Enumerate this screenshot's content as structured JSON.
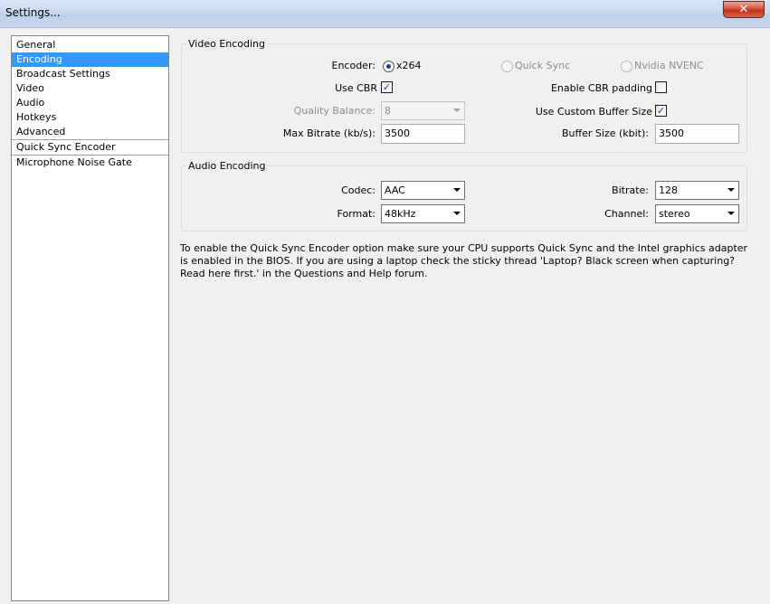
{
  "window": {
    "title": "Settings...",
    "close_glyph": "✕"
  },
  "sidebar": {
    "items": [
      {
        "label": "General"
      },
      {
        "label": "Encoding"
      },
      {
        "label": "Broadcast Settings"
      },
      {
        "label": "Video"
      },
      {
        "label": "Audio"
      },
      {
        "label": "Hotkeys"
      },
      {
        "label": "Advanced"
      },
      {
        "label": "Quick Sync Encoder"
      },
      {
        "label": "Microphone Noise Gate"
      }
    ],
    "selected": "Encoding"
  },
  "video_encoding": {
    "group_label": "Video Encoding",
    "encoder_label": "Encoder:",
    "encoder_options": [
      {
        "label": "x264",
        "selected": true,
        "enabled": true
      },
      {
        "label": "Quick Sync",
        "selected": false,
        "enabled": false
      },
      {
        "label": "Nvidia NVENC",
        "selected": false,
        "enabled": false
      }
    ],
    "use_cbr_label": "Use CBR",
    "use_cbr_checked": true,
    "cbr_padding_label": "Enable CBR padding",
    "cbr_padding_checked": false,
    "quality_balance_label": "Quality Balance:",
    "quality_balance_value": "8",
    "custom_buffer_label": "Use Custom Buffer Size",
    "custom_buffer_checked": true,
    "max_bitrate_label": "Max Bitrate (kb/s):",
    "max_bitrate_value": "3500",
    "buffer_size_label": "Buffer Size (kbit):",
    "buffer_size_value": "3500",
    "check_glyph": "✓"
  },
  "audio_encoding": {
    "group_label": "Audio Encoding",
    "codec_label": "Codec:",
    "codec_value": "AAC",
    "bitrate_label": "Bitrate:",
    "bitrate_value": "128",
    "format_label": "Format:",
    "format_value": "48kHz",
    "channel_label": "Channel:",
    "channel_value": "stereo"
  },
  "note": "To enable the Quick Sync Encoder option make sure your CPU supports Quick Sync and the Intel graphics adapter is enabled in the BIOS. If you are using a laptop check the sticky thread 'Laptop? Black screen when capturing? Read here first.' in the Questions and Help forum."
}
